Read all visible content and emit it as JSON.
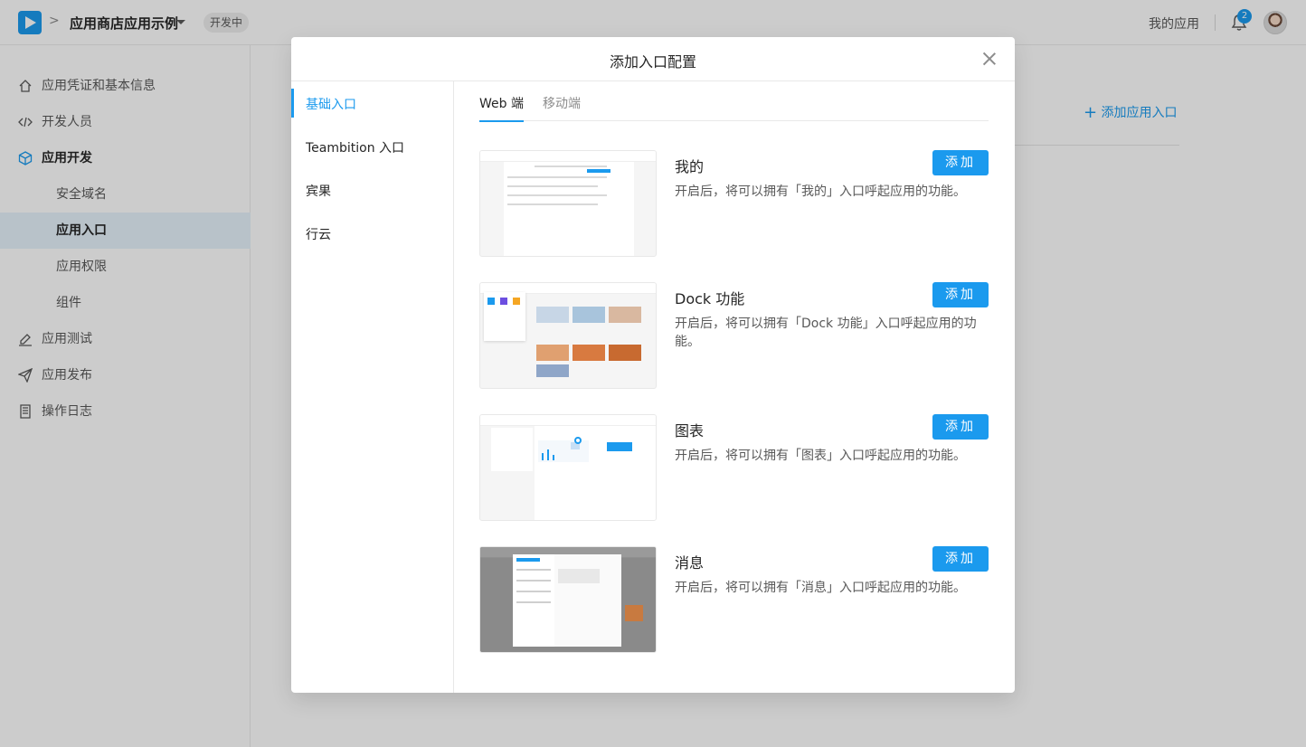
{
  "header": {
    "breadcrumb_sep": ">",
    "app_name": "应用商店应用示例",
    "status": "开发中",
    "my_apps": "我的应用",
    "notification_count": "2"
  },
  "sidebar": {
    "items": [
      {
        "label": "应用凭证和基本信息",
        "icon": "home-icon"
      },
      {
        "label": "开发人员",
        "icon": "code-icon"
      },
      {
        "label": "应用开发",
        "icon": "cube-icon"
      },
      {
        "label": "安全域名"
      },
      {
        "label": "应用入口"
      },
      {
        "label": "应用权限"
      },
      {
        "label": "组件"
      },
      {
        "label": "应用测试",
        "icon": "pen-icon"
      },
      {
        "label": "应用发布",
        "icon": "send-icon"
      },
      {
        "label": "操作日志",
        "icon": "log-icon"
      }
    ]
  },
  "content": {
    "add_entry": "添加应用入口"
  },
  "modal": {
    "title": "添加入口配置",
    "nav": [
      "基础入口",
      "Teambition 入口",
      "宾果",
      "行云"
    ],
    "tabs": [
      "Web 端",
      "移动端"
    ],
    "add_label": "添加",
    "entries": [
      {
        "title": "我的",
        "desc": "开启后，将可以拥有「我的」入口呼起应用的功能。"
      },
      {
        "title": "Dock 功能",
        "desc": "开启后，将可以拥有「Dock 功能」入口呼起应用的功能。"
      },
      {
        "title": "图表",
        "desc": "开启后，将可以拥有「图表」入口呼起应用的功能。"
      },
      {
        "title": "消息",
        "desc": "开启后，将可以拥有「消息」入口呼起应用的功能。"
      }
    ]
  },
  "colors": {
    "accent": "#1b9aee",
    "overlay": "rgba(0,0,0,0.2)"
  }
}
